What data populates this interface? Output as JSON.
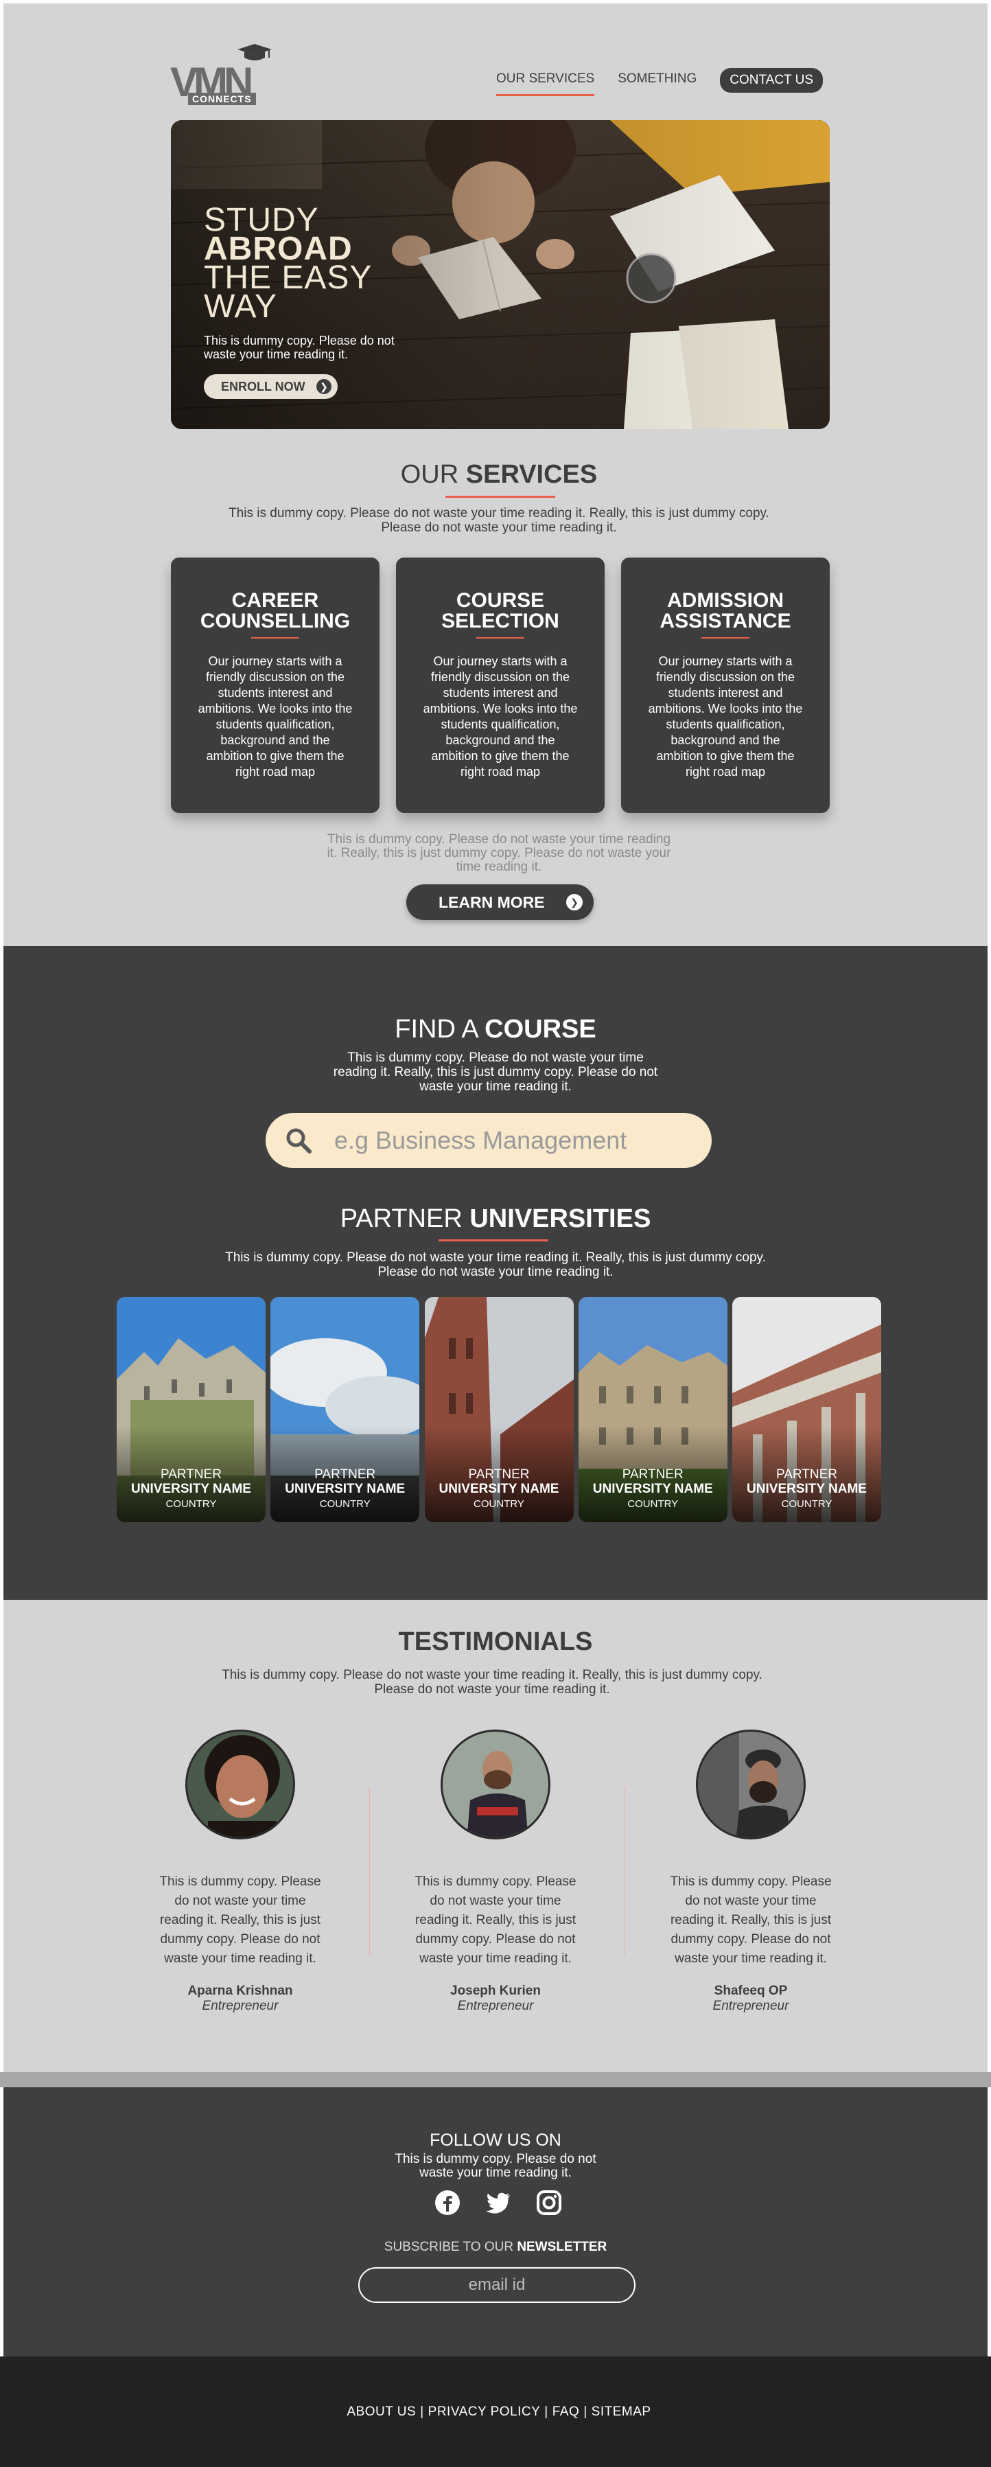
{
  "brand": {
    "logo_text": "VMN",
    "logo_sub": "CONNECTS"
  },
  "nav": {
    "items": [
      "OUR SERVICES",
      "SOMETHING"
    ],
    "contact": "CONTACT US"
  },
  "hero": {
    "title_lines": [
      "STUDY",
      "ABROAD",
      "THE EASY",
      "WAY"
    ],
    "subtitle": "This is dummy copy. Please do not waste your time reading it.",
    "button": "ENROLL NOW"
  },
  "services": {
    "title_light": "OUR ",
    "title_bold": "SERVICES",
    "desc": "This is dummy copy. Please do not waste your time reading it. Really, this is just dummy copy. Please do not waste your time reading it.",
    "cards": [
      {
        "title1": "CAREER",
        "title2": "COUNSELLING",
        "text": "Our journey starts with a friendly discussion on the students interest and ambitions. We looks into the students qualification, background and the ambition to give them the right road map"
      },
      {
        "title1": "COURSE",
        "title2": "SELECTION",
        "text": "Our journey starts with a friendly discussion on the students interest and ambitions. We looks into the students qualification, background and the ambition to give them the right road map"
      },
      {
        "title1": "ADMISSION",
        "title2": "ASSISTANCE",
        "text": "Our journey starts with a friendly discussion on the students interest and ambitions. We looks into the students qualification, background and the ambition to give them the right road map"
      }
    ],
    "note": "This is dummy copy. Please do not waste your time reading it. Really, this is just dummy copy. Please do not waste your time reading it.",
    "button": "LEARN MORE"
  },
  "find_course": {
    "title_light": "FIND A ",
    "title_bold": "COURSE",
    "desc": "This is dummy copy. Please do not waste your time reading it. Really, this is just dummy copy. Please do not waste your time reading it.",
    "search_placeholder": "e.g Business Management"
  },
  "partners": {
    "title_light": "PARTNER ",
    "title_bold": "UNIVERSITIES",
    "desc": "This is dummy copy. Please do not waste your time reading it. Really, this is just dummy copy. Please do not waste your time reading it.",
    "items": [
      {
        "line1": "PARTNER",
        "line2": "UNIVERSITY NAME",
        "line3": "COUNTRY"
      },
      {
        "line1": "PARTNER",
        "line2": "UNIVERSITY NAME",
        "line3": "COUNTRY"
      },
      {
        "line1": "PARTNER",
        "line2": "UNIVERSITY NAME",
        "line3": "COUNTRY"
      },
      {
        "line1": "PARTNER",
        "line2": "UNIVERSITY NAME",
        "line3": "COUNTRY"
      },
      {
        "line1": "PARTNER",
        "line2": "UNIVERSITY NAME",
        "line3": "COUNTRY"
      }
    ]
  },
  "testimonials": {
    "title": "TESTIMONIALS",
    "desc": "This is dummy copy. Please do not waste your time reading it. Really, this is just dummy copy. Please do not waste your time reading it.",
    "items": [
      {
        "text": "This is dummy copy. Please do not waste your time reading it. Really, this is just dummy copy. Please do not waste your time reading it.",
        "name": "Aparna Krishnan",
        "role": "Entrepreneur"
      },
      {
        "text": "This is dummy copy. Please do not waste your time reading it. Really, this is just dummy copy. Please do not waste your time reading it.",
        "name": "Joseph Kurien",
        "role": "Entrepreneur"
      },
      {
        "text": "This is dummy copy. Please do not waste your time reading it. Really, this is just dummy copy. Please do not waste your time reading it.",
        "name": "Shafeeq OP",
        "role": "Entrepreneur"
      }
    ]
  },
  "footer": {
    "follow_title": "FOLLOW US ON",
    "follow_desc": "This is dummy copy. Please do not waste your time reading it.",
    "socials": [
      "facebook-icon",
      "twitter-icon",
      "instagram-icon"
    ],
    "newsletter_light": "SUBSCRIBE TO OUR ",
    "newsletter_bold": "NEWSLETTER",
    "email_placeholder": "email id",
    "links": [
      "ABOUT US",
      "PRIVACY POLICY",
      "FAQ",
      "SITEMAP"
    ]
  },
  "colors": {
    "accent": "#e8604c",
    "dark": "#3f3f3f",
    "light": "#d4d4d4",
    "search_bg": "#fbe9cc"
  }
}
